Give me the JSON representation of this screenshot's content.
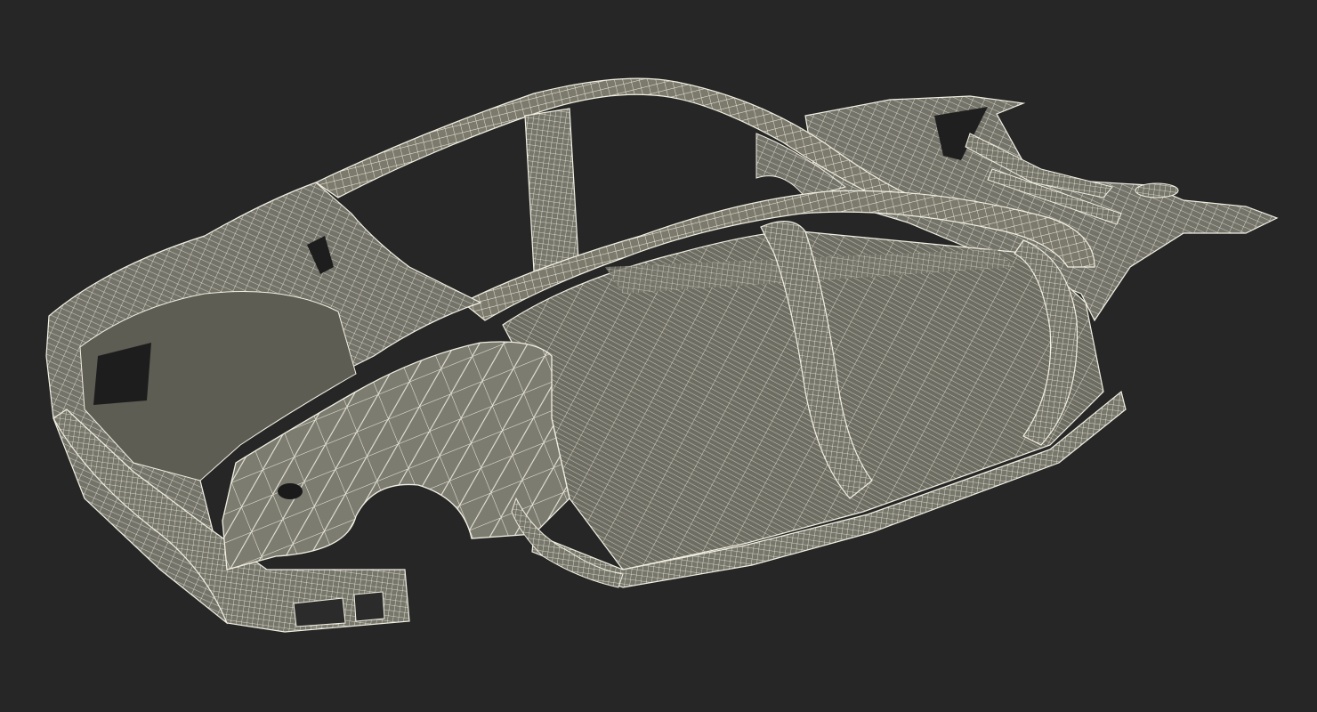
{
  "scene": {
    "subject": "car-body-in-white-wireframe",
    "background_color": "#262626",
    "surface_color": "#7b7a6d",
    "surface_dark_color": "#5f5e54",
    "wire_color": "#f2f0e2",
    "cavity_color": "#1c1c1c"
  }
}
